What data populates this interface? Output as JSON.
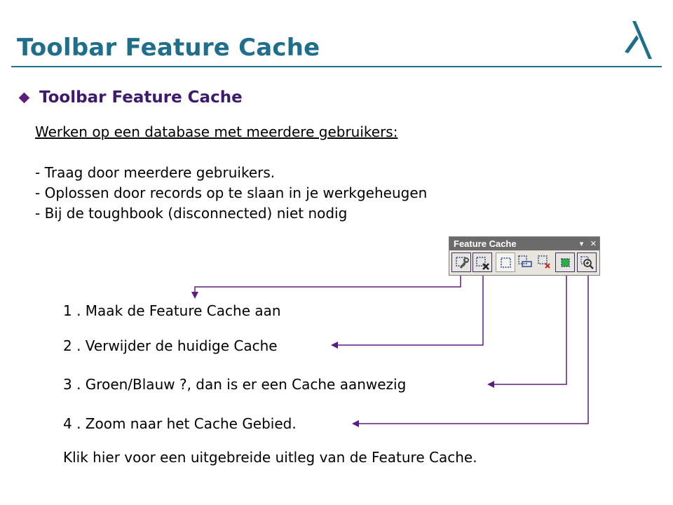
{
  "page": {
    "title": "Toolbar Feature Cache",
    "bullet_heading": "Toolbar Feature Cache",
    "subheading": "Werken op een database met meerdere gebruikers:",
    "points": [
      "- Traag door meerdere gebruikers.",
      "- Oplossen door records op te slaan in je werkgeheugen",
      "- Bij de toughbook (disconnected) niet nodig"
    ],
    "steps": [
      "1 . Maak de Feature Cache aan",
      "2 . Verwijder de huidige Cache",
      "3 . Groen/Blauw ?, dan is er een Cache aanwezig",
      "4 . Zoom naar het Cache Gebied."
    ],
    "footer_link": "Klik hier voor een uitgebreide uitleg van de Feature Cache."
  },
  "toolbar": {
    "title": "Feature Cache",
    "dropdown_glyph": "▾",
    "close_glyph": "✕",
    "buttons": [
      {
        "icon": "build-cache-icon"
      },
      {
        "icon": "delete-cache-icon"
      },
      {
        "icon": "select-extent-icon"
      },
      {
        "icon": "cache-extent-icon"
      },
      {
        "icon": "clear-extent-icon"
      },
      {
        "icon": "cache-status-icon"
      },
      {
        "icon": "zoom-to-cache-icon"
      }
    ]
  },
  "colors": {
    "title": "#1f6e8c",
    "bullet": "#5b1e7f",
    "bullet_text": "#3e1a6e",
    "arrow_lines": "#5b1e7f",
    "toolbar_title_bg": "#6b6b6b",
    "toolbar_bg": "#e8e6dc"
  }
}
